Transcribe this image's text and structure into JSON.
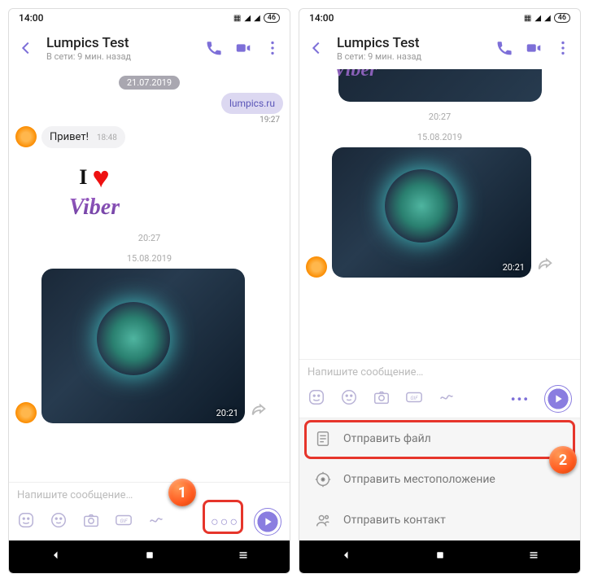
{
  "status": {
    "time": "14:00",
    "battery": "46"
  },
  "header": {
    "title": "Lumpics Test",
    "subtitle": "В сети: 9 мин. назад"
  },
  "left": {
    "datePill": "21.07.2019",
    "linkBubble": "lumpics.ru",
    "linkTime": "19:27",
    "greeting": "Привет!",
    "greetingTime": "18:48",
    "stickerTime": "20:27",
    "dateSep": "15.08.2019",
    "mediaTime": "20:21",
    "placeholder": "Напишите сообщение…"
  },
  "right": {
    "peekTime": "20:27",
    "dateSep": "15.08.2019",
    "mediaTime": "20:21",
    "placeholder": "Напишите сообщение…",
    "attach": {
      "file": "Отправить файл",
      "location": "Отправить местоположение",
      "contact": "Отправить контакт"
    }
  },
  "markers": {
    "one": "1",
    "two": "2"
  }
}
